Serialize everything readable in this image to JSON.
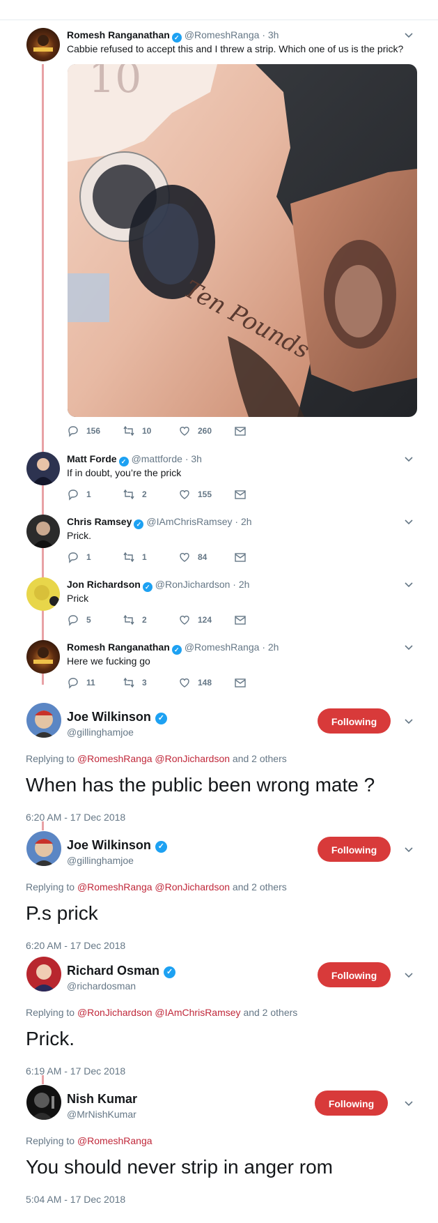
{
  "tweets": [
    {
      "name": "Romesh Ranganathan",
      "handle": "@RomeshRanga",
      "time": "· 3h",
      "text": "Cabbie refused to accept this and I threw a strip. Which one of us is the prick?",
      "replies": "156",
      "retweets": "10",
      "likes": "260"
    },
    {
      "name": "Matt Forde",
      "handle": "@mattforde",
      "time": "· 3h",
      "text": "If in doubt, you’re the prick",
      "replies": "1",
      "retweets": "2",
      "likes": "155"
    },
    {
      "name": "Chris Ramsey",
      "handle": "@IAmChrisRamsey",
      "time": "· 2h",
      "text": "Prick.",
      "replies": "1",
      "retweets": "1",
      "likes": "84"
    },
    {
      "name": "Jon Richardson",
      "handle": "@RonJichardson",
      "time": "· 2h",
      "text": "Prick",
      "replies": "5",
      "retweets": "2",
      "likes": "124"
    },
    {
      "name": "Romesh Ranganathan",
      "handle": "@RomeshRanga",
      "time": "· 2h",
      "text": "Here we fucking go",
      "replies": "11",
      "retweets": "3",
      "likes": "148"
    }
  ],
  "expanded": [
    {
      "name": "Joe Wilkinson",
      "handle": "@gillinghamjoe",
      "follow_label": "Following",
      "replying_prefix": "Replying to",
      "mentions": "@RomeshRanga @RonJichardson",
      "others": "and 2 others",
      "text": "When has the public been wrong mate ?",
      "date": "6:20 AM - 17 Dec 2018"
    },
    {
      "name": "Joe Wilkinson",
      "handle": "@gillinghamjoe",
      "follow_label": "Following",
      "replying_prefix": "Replying to",
      "mentions": "@RomeshRanga @RonJichardson",
      "others": "and 2 others",
      "text": "P.s prick",
      "date": "6:20 AM - 17 Dec 2018"
    },
    {
      "name": "Richard Osman",
      "handle": "@richardosman",
      "follow_label": "Following",
      "replying_prefix": "Replying to",
      "mentions": "@RonJichardson @IAmChrisRamsey",
      "others": "and 2 others",
      "text": "Prick.",
      "date": "6:19 AM - 17 Dec 2018"
    },
    {
      "name": "Nish Kumar",
      "handle": "@MrNishKumar",
      "follow_label": "Following",
      "replying_prefix": "Replying to",
      "mentions": "@RomeshRanga",
      "others": "",
      "text": "You should never strip in anger rom",
      "date": "5:04 AM - 17 Dec 2018"
    }
  ],
  "photo": {
    "banknote_text": "Ten Pounds",
    "denomination": "10"
  },
  "colors": {
    "accent": "#d83a3a",
    "link": "#c0283a",
    "thread": "#e8a1a5",
    "verified": "#1da1f2"
  }
}
